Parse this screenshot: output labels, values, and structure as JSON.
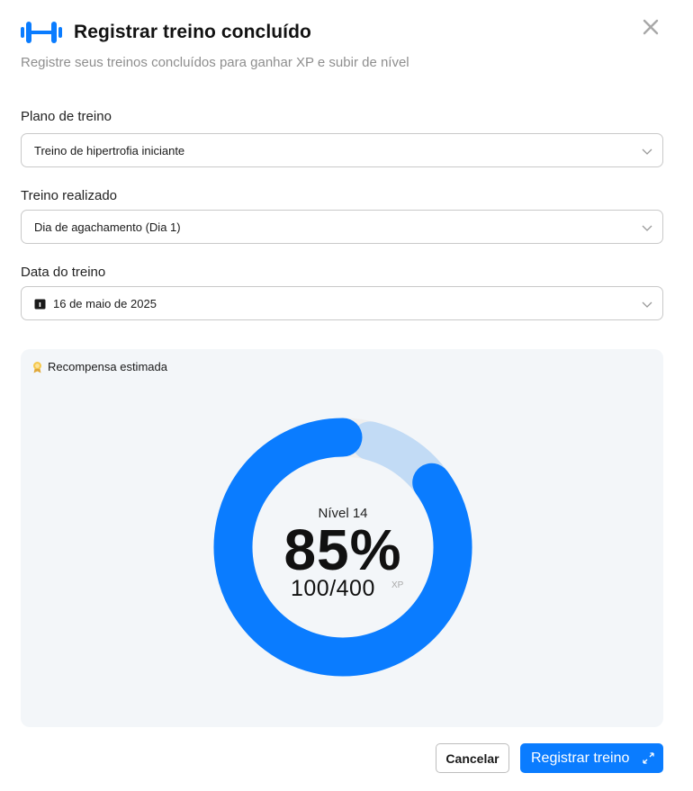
{
  "header": {
    "title": "Registrar treino concluído",
    "subtitle": "Registre seus treinos concluídos para ganhar XP e subir de nível",
    "logo_icon": "dumbbell-h-icon",
    "close_icon": "close-icon"
  },
  "form": {
    "plan": {
      "label": "Plano de treino",
      "value": "Treino de hipertrofia iniciante"
    },
    "workout": {
      "label": "Treino realizado",
      "value": "Dia de agachamento (Dia 1)"
    },
    "date": {
      "label": "Data do treino",
      "value": "16 de maio de 2025",
      "icon": "calendar-icon"
    }
  },
  "reward": {
    "label": "Recompensa estimada",
    "icon": "medal-icon",
    "level": "Nível 14",
    "percent_text": "85%",
    "xp_text": "100/400",
    "xp_unit": "XP",
    "progress_fraction": 0.85,
    "gained_fraction": 0.11
  },
  "actions": {
    "cancel": "Cancelar",
    "submit": "Registrar treino",
    "submit_icon": "expand-arrows-icon"
  },
  "colors": {
    "accent": "#0a7cff",
    "gain": "#c2dbf5",
    "track": "#efefef",
    "card_bg": "#f3f6f9"
  }
}
